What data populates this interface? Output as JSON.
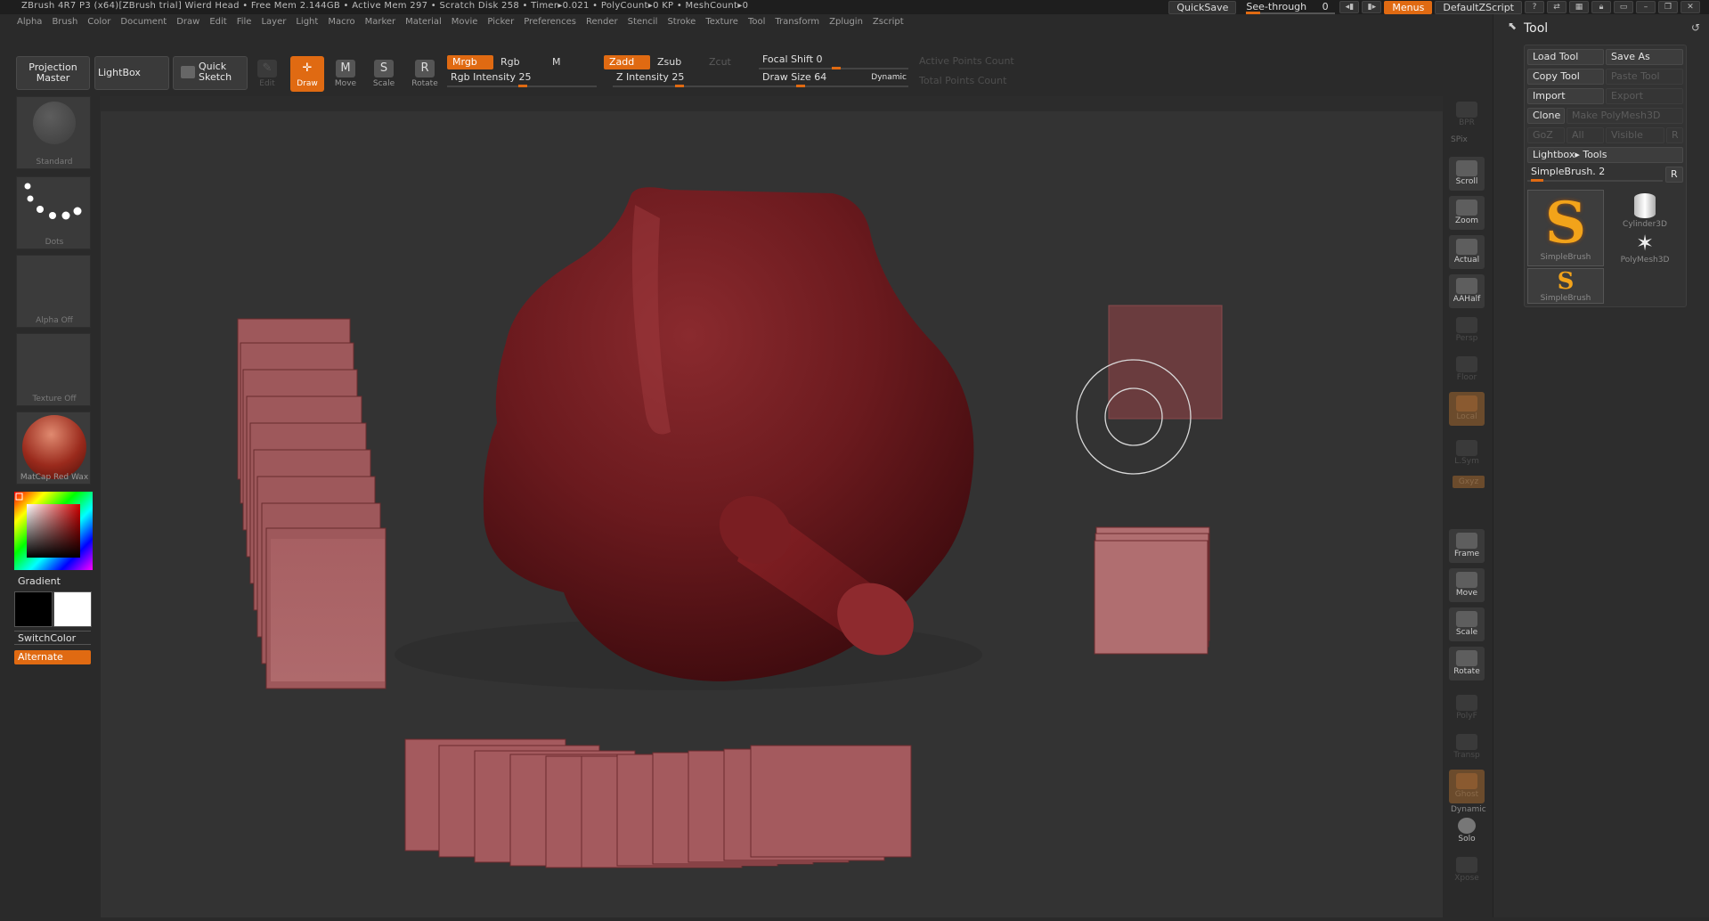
{
  "titlebar": {
    "title": "ZBrush 4R7 P3 (x64)[ZBrush trial]   Wierd Head   • Free Mem 2.144GB • Active Mem 297 • Scratch Disk 258 •  Timer▸0.021 • PolyCount▸0 KP • MeshCount▸0",
    "quicksave": "QuickSave",
    "see_through_label": "See-through",
    "see_through_value": "0",
    "menus": "Menus",
    "script": "DefaultZScript"
  },
  "menubar": [
    "Alpha",
    "Brush",
    "Color",
    "Document",
    "Draw",
    "Edit",
    "File",
    "Layer",
    "Light",
    "Macro",
    "Marker",
    "Material",
    "Movie",
    "Picker",
    "Preferences",
    "Render",
    "Stencil",
    "Stroke",
    "Texture",
    "Tool",
    "Transform",
    "Zplugin",
    "Zscript"
  ],
  "toolbar": {
    "projection_master": "Projection Master",
    "lightbox": "LightBox",
    "quick_sketch": "Quick Sketch",
    "edit": "Edit",
    "draw": "Draw",
    "move": "Move",
    "scale": "Scale",
    "rotate": "Rotate",
    "mrgb": "Mrgb",
    "rgb": "Rgb",
    "m": "M",
    "zadd": "Zadd",
    "zsub": "Zsub",
    "zcut": "Zcut",
    "rgb_intensity": "Rgb  Intensity 25",
    "z_intensity": "Z  Intensity 25",
    "focal_shift": "Focal  Shift 0",
    "draw_size": "Draw  Size 64",
    "dynamic": "Dynamic",
    "active_points": "Active  Points  Count",
    "total_points": "Total  Points  Count",
    "rgb_intensity_value": 25,
    "z_intensity_value": 25,
    "focal_shift_value": 0,
    "draw_size_value": 64
  },
  "leftpanel": {
    "standard": "Standard",
    "dots": "Dots",
    "alpha": "Alpha  Off",
    "texture": "Texture  Off",
    "matcap": "MatCap  Red  Wax",
    "gradient": "Gradient",
    "switchcolor": "SwitchColor",
    "alternate": "Alternate"
  },
  "rightstrip": {
    "bpr": "BPR",
    "spix": "SPix",
    "scroll": "Scroll",
    "zoom": "Zoom",
    "actual": "Actual",
    "aahalf": "AAHalf",
    "persp": "Persp",
    "floor": "Floor",
    "local": "Local",
    "lsym": "L.Sym",
    "xyz": "Gxyz",
    "frame": "Frame",
    "move": "Move",
    "scale": "Scale",
    "rotate": "Rotate",
    "polyf": "PolyF",
    "transp": "Transp",
    "ghost": "Ghost",
    "dynamic": "Dynamic",
    "solo": "Solo",
    "xpose": "Xpose"
  },
  "toolpanel": {
    "title": "Tool",
    "load_tool": "Load  Tool",
    "save_as": "Save  As",
    "copy_tool": "Copy  Tool",
    "paste_tool": "Paste  Tool",
    "import": "Import",
    "export": "Export",
    "clone": "Clone",
    "make_polymesh": "Make  PolyMesh3D",
    "goz": "GoZ",
    "all": "All",
    "visible": "Visible",
    "r": "R",
    "lightbox_tools": "Lightbox▸ Tools",
    "current_tool": "SimpleBrush. 2",
    "r2": "R",
    "slots": [
      "SimpleBrush",
      "Cylinder3D",
      "PolyMesh3D",
      "SimpleBrush"
    ]
  },
  "colors": {
    "accent": "#e06a12",
    "model": "#6e1b1f",
    "stroke_pink": "#b5686a"
  }
}
